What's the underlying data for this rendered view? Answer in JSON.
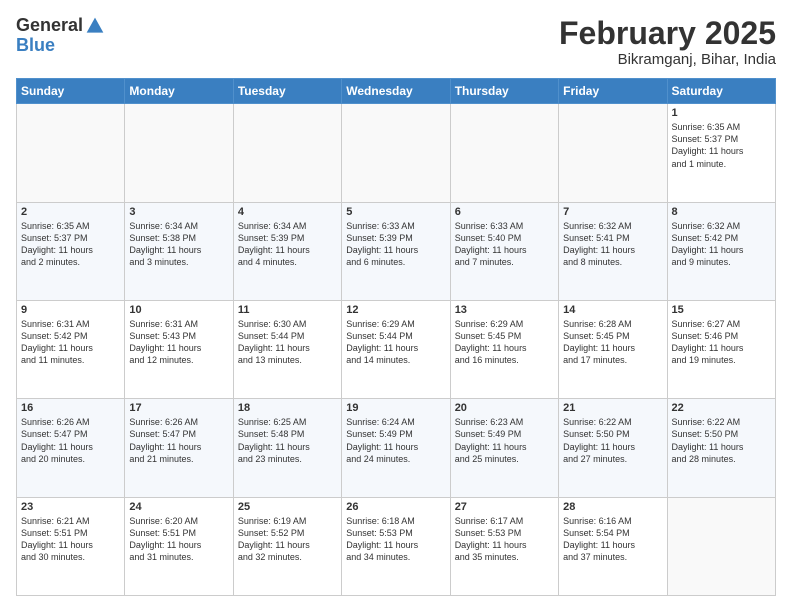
{
  "header": {
    "logo_general": "General",
    "logo_blue": "Blue",
    "month_title": "February 2025",
    "location": "Bikramganj, Bihar, India"
  },
  "days_of_week": [
    "Sunday",
    "Monday",
    "Tuesday",
    "Wednesday",
    "Thursday",
    "Friday",
    "Saturday"
  ],
  "weeks": [
    [
      {
        "day": "",
        "content": ""
      },
      {
        "day": "",
        "content": ""
      },
      {
        "day": "",
        "content": ""
      },
      {
        "day": "",
        "content": ""
      },
      {
        "day": "",
        "content": ""
      },
      {
        "day": "",
        "content": ""
      },
      {
        "day": "1",
        "content": "Sunrise: 6:35 AM\nSunset: 5:37 PM\nDaylight: 11 hours\nand 1 minute."
      }
    ],
    [
      {
        "day": "2",
        "content": "Sunrise: 6:35 AM\nSunset: 5:37 PM\nDaylight: 11 hours\nand 2 minutes."
      },
      {
        "day": "3",
        "content": "Sunrise: 6:34 AM\nSunset: 5:38 PM\nDaylight: 11 hours\nand 3 minutes."
      },
      {
        "day": "4",
        "content": "Sunrise: 6:34 AM\nSunset: 5:39 PM\nDaylight: 11 hours\nand 4 minutes."
      },
      {
        "day": "5",
        "content": "Sunrise: 6:33 AM\nSunset: 5:39 PM\nDaylight: 11 hours\nand 6 minutes."
      },
      {
        "day": "6",
        "content": "Sunrise: 6:33 AM\nSunset: 5:40 PM\nDaylight: 11 hours\nand 7 minutes."
      },
      {
        "day": "7",
        "content": "Sunrise: 6:32 AM\nSunset: 5:41 PM\nDaylight: 11 hours\nand 8 minutes."
      },
      {
        "day": "8",
        "content": "Sunrise: 6:32 AM\nSunset: 5:42 PM\nDaylight: 11 hours\nand 9 minutes."
      }
    ],
    [
      {
        "day": "9",
        "content": "Sunrise: 6:31 AM\nSunset: 5:42 PM\nDaylight: 11 hours\nand 11 minutes."
      },
      {
        "day": "10",
        "content": "Sunrise: 6:31 AM\nSunset: 5:43 PM\nDaylight: 11 hours\nand 12 minutes."
      },
      {
        "day": "11",
        "content": "Sunrise: 6:30 AM\nSunset: 5:44 PM\nDaylight: 11 hours\nand 13 minutes."
      },
      {
        "day": "12",
        "content": "Sunrise: 6:29 AM\nSunset: 5:44 PM\nDaylight: 11 hours\nand 14 minutes."
      },
      {
        "day": "13",
        "content": "Sunrise: 6:29 AM\nSunset: 5:45 PM\nDaylight: 11 hours\nand 16 minutes."
      },
      {
        "day": "14",
        "content": "Sunrise: 6:28 AM\nSunset: 5:45 PM\nDaylight: 11 hours\nand 17 minutes."
      },
      {
        "day": "15",
        "content": "Sunrise: 6:27 AM\nSunset: 5:46 PM\nDaylight: 11 hours\nand 19 minutes."
      }
    ],
    [
      {
        "day": "16",
        "content": "Sunrise: 6:26 AM\nSunset: 5:47 PM\nDaylight: 11 hours\nand 20 minutes."
      },
      {
        "day": "17",
        "content": "Sunrise: 6:26 AM\nSunset: 5:47 PM\nDaylight: 11 hours\nand 21 minutes."
      },
      {
        "day": "18",
        "content": "Sunrise: 6:25 AM\nSunset: 5:48 PM\nDaylight: 11 hours\nand 23 minutes."
      },
      {
        "day": "19",
        "content": "Sunrise: 6:24 AM\nSunset: 5:49 PM\nDaylight: 11 hours\nand 24 minutes."
      },
      {
        "day": "20",
        "content": "Sunrise: 6:23 AM\nSunset: 5:49 PM\nDaylight: 11 hours\nand 25 minutes."
      },
      {
        "day": "21",
        "content": "Sunrise: 6:22 AM\nSunset: 5:50 PM\nDaylight: 11 hours\nand 27 minutes."
      },
      {
        "day": "22",
        "content": "Sunrise: 6:22 AM\nSunset: 5:50 PM\nDaylight: 11 hours\nand 28 minutes."
      }
    ],
    [
      {
        "day": "23",
        "content": "Sunrise: 6:21 AM\nSunset: 5:51 PM\nDaylight: 11 hours\nand 30 minutes."
      },
      {
        "day": "24",
        "content": "Sunrise: 6:20 AM\nSunset: 5:51 PM\nDaylight: 11 hours\nand 31 minutes."
      },
      {
        "day": "25",
        "content": "Sunrise: 6:19 AM\nSunset: 5:52 PM\nDaylight: 11 hours\nand 32 minutes."
      },
      {
        "day": "26",
        "content": "Sunrise: 6:18 AM\nSunset: 5:53 PM\nDaylight: 11 hours\nand 34 minutes."
      },
      {
        "day": "27",
        "content": "Sunrise: 6:17 AM\nSunset: 5:53 PM\nDaylight: 11 hours\nand 35 minutes."
      },
      {
        "day": "28",
        "content": "Sunrise: 6:16 AM\nSunset: 5:54 PM\nDaylight: 11 hours\nand 37 minutes."
      },
      {
        "day": "",
        "content": ""
      }
    ]
  ]
}
